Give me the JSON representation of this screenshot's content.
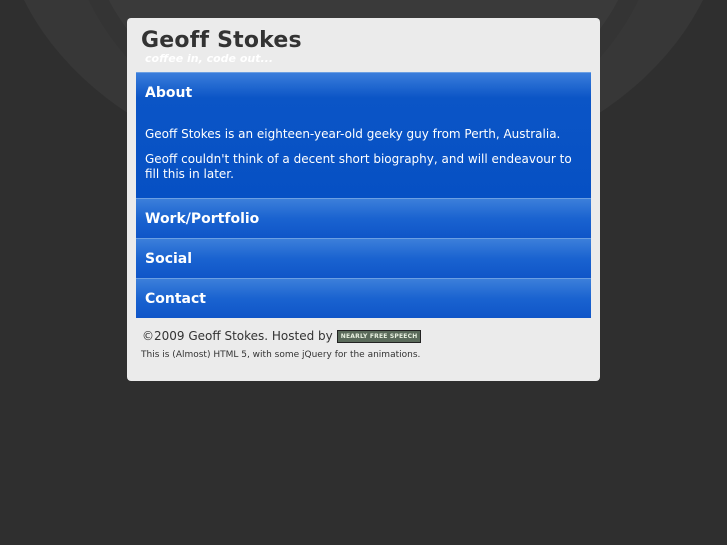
{
  "header": {
    "title": "Geoff Stokes",
    "tagline": "coffee in, code out..."
  },
  "sections": [
    {
      "label": "About",
      "expanded": true,
      "paragraphs": [
        "Geoff Stokes is an eighteen-year-old geeky guy from Perth, Australia.",
        "Geoff couldn't think of a decent short biography, and will endeavour to fill this in later."
      ]
    },
    {
      "label": "Work/Portfolio",
      "expanded": false
    },
    {
      "label": "Social",
      "expanded": false
    },
    {
      "label": "Contact",
      "expanded": false
    }
  ],
  "footer": {
    "copyright": "©2009 Geoff Stokes. Hosted by",
    "host_badge": "NEARLY FREE SPEECH",
    "note": "This is (Almost) HTML 5, with some jQuery for the animations."
  },
  "colors": {
    "background": "#2f2f2f",
    "panel": "#ebebeb",
    "accordion_blue": "#0f55c8",
    "title_text": "#333333"
  }
}
